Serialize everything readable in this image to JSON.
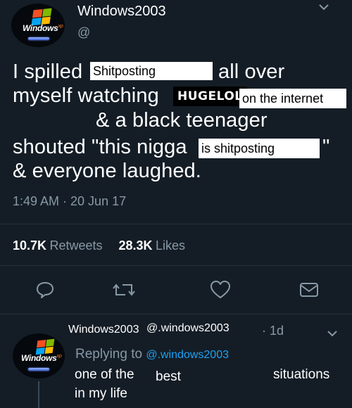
{
  "tweet": {
    "author_name": "Windows2003",
    "author_handle": "@",
    "avatar_text": "Windows",
    "avatar_superscript": "xp",
    "text_lines": {
      "l1a": "I spilled",
      "l1_label": "Shitposting",
      "l1b": "all over",
      "l2a": "myself watching",
      "l2_logo": "HUGELOL",
      "l2_label": "on the internet",
      "l3": "& a black teenager",
      "l4a": "shouted \"this nigga",
      "l4_label": "is shitposting",
      "l4b": "\"",
      "l5": "& everyone laughed."
    },
    "timestamp": "1:49 AM · 20 Jun 17",
    "retweets_count": "10.7K",
    "retweets_label": "Retweets",
    "likes_count": "28.3K",
    "likes_label": "Likes",
    "icons": [
      "chevron-down-icon",
      "reply-icon",
      "retweet-icon",
      "like-icon",
      "message-icon"
    ]
  },
  "reply": {
    "author_name": "Windows2003",
    "author_handle": "@.windows2003",
    "time": "· 1d",
    "replying_prefix": "Replying to",
    "replying_handle": "@.windows2003",
    "avatar_text": "Windows",
    "avatar_superscript": "xp",
    "text": {
      "a": "one of the",
      "b": "best",
      "c": "situations",
      "d": "in my life"
    }
  },
  "colors": {
    "background": "#141d26",
    "muted": "#8899a6",
    "link": "#1da1f2",
    "divider": "#24303c"
  }
}
